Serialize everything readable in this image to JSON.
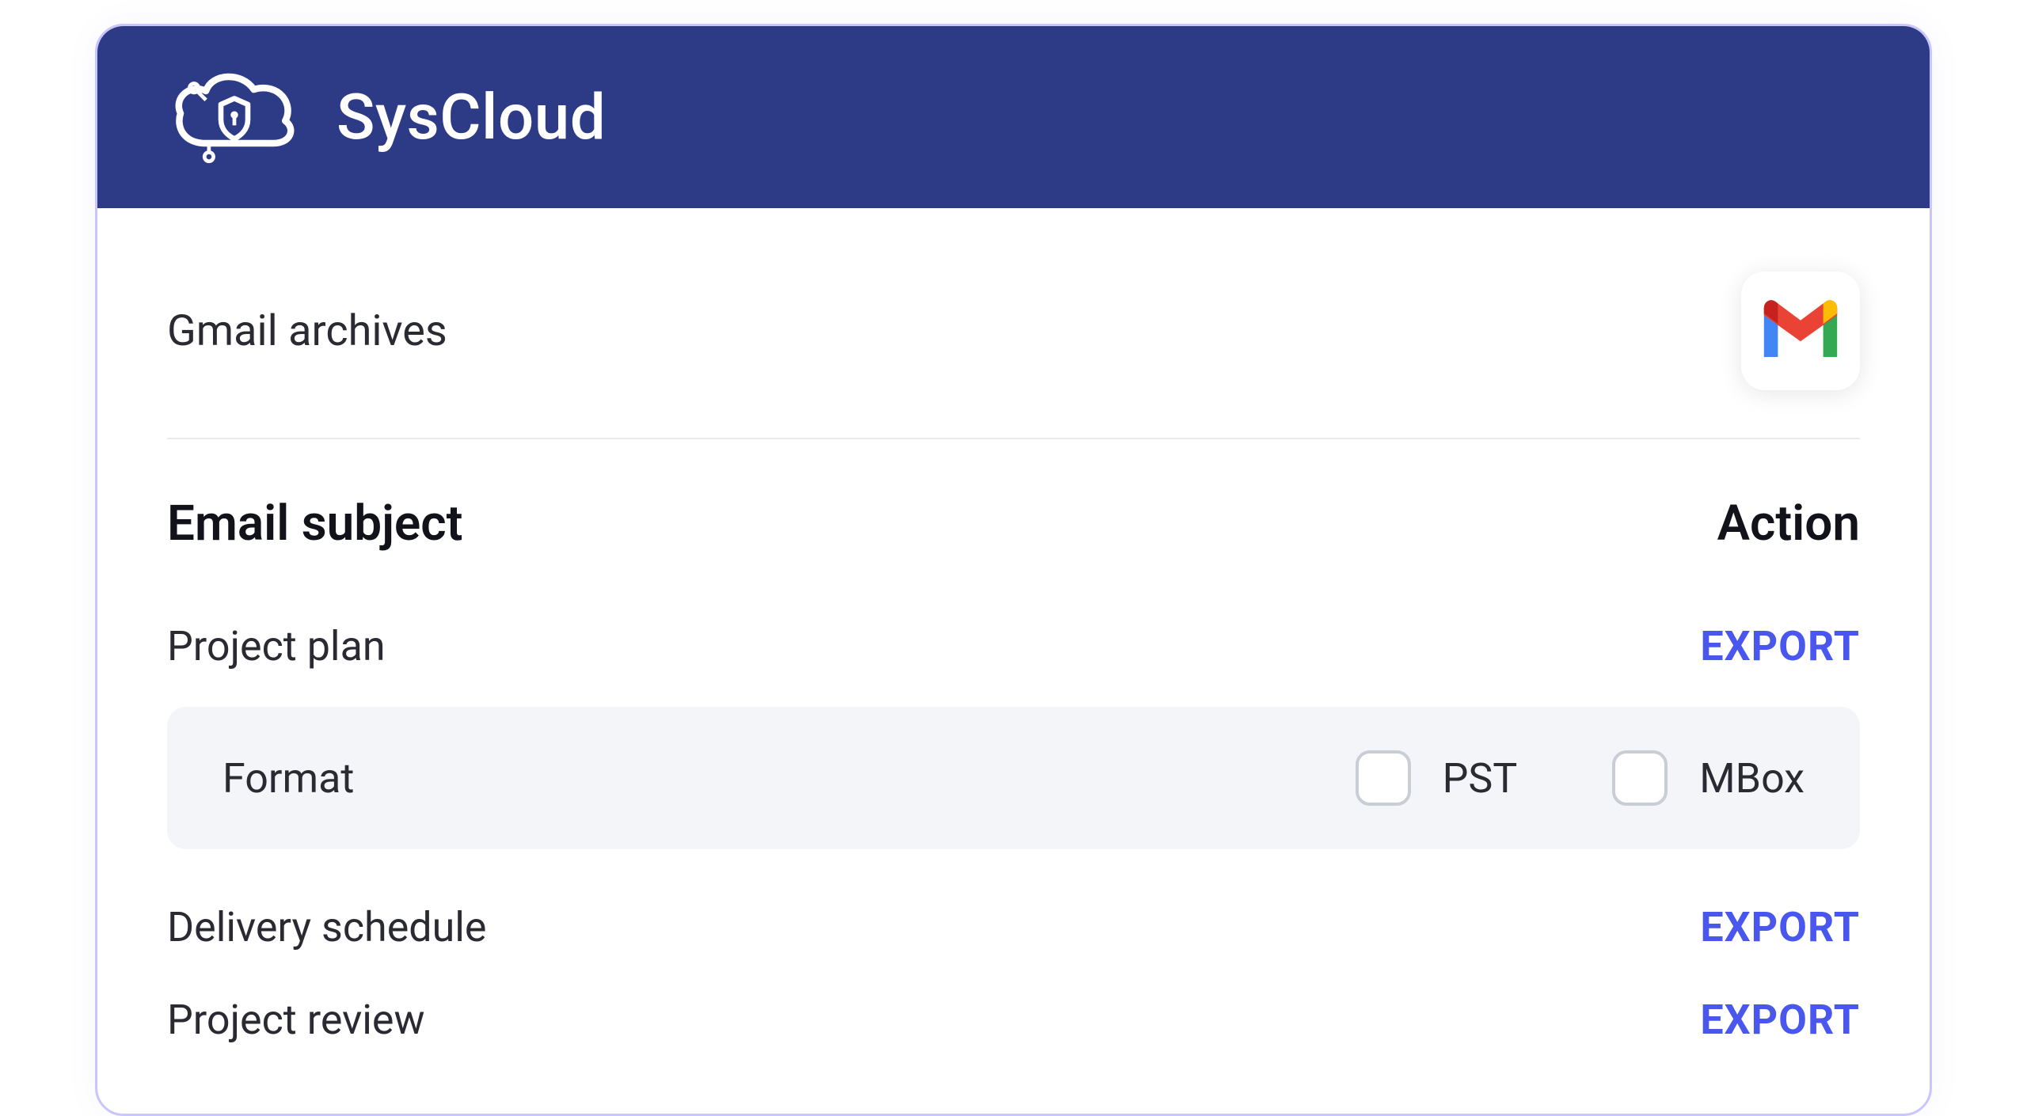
{
  "header": {
    "brand": "SysCloud"
  },
  "section": {
    "title": "Gmail archives"
  },
  "columns": {
    "subject": "Email subject",
    "action": "Action"
  },
  "emails": [
    {
      "subject": "Project plan",
      "action": "EXPORT"
    },
    {
      "subject": "Delivery schedule",
      "action": "EXPORT"
    },
    {
      "subject": "Project review",
      "action": "EXPORT"
    }
  ],
  "format_panel": {
    "label": "Format",
    "options": [
      {
        "label": "PST"
      },
      {
        "label": "MBox"
      }
    ]
  }
}
